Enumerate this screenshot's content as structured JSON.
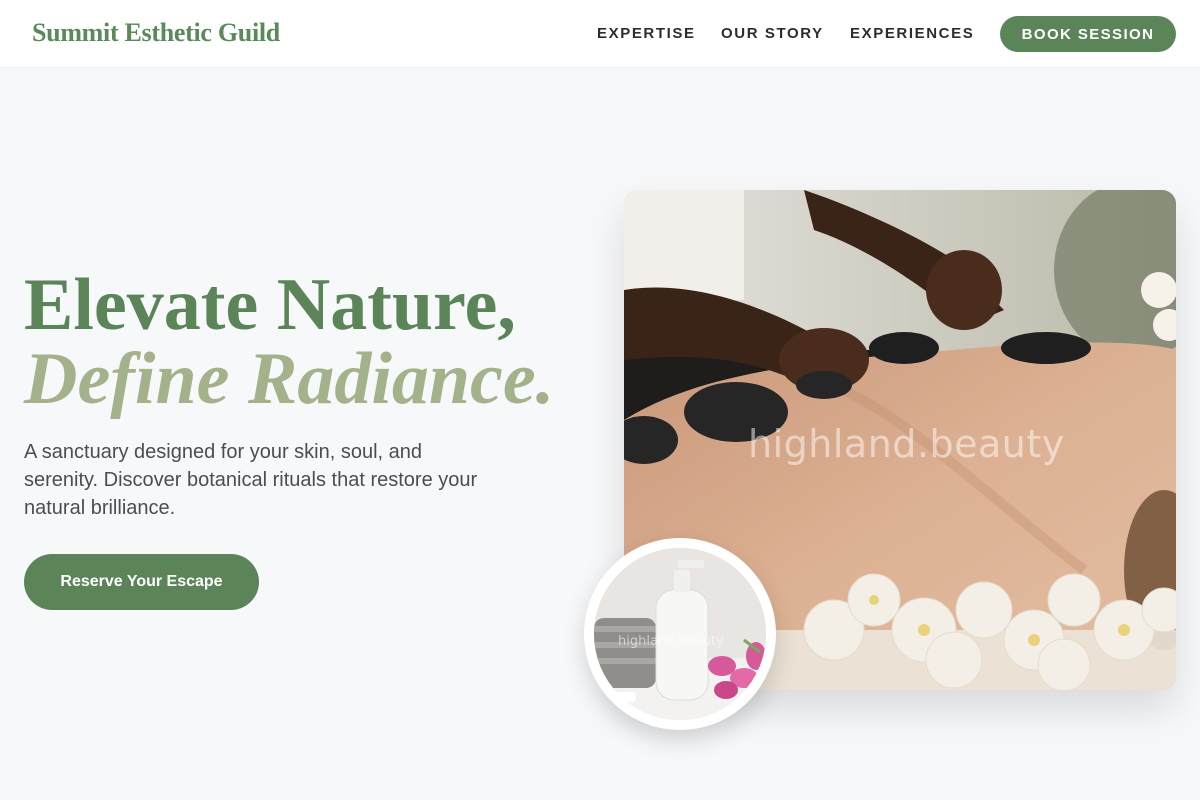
{
  "brand": {
    "name": "Summit Esthetic Guild"
  },
  "nav": {
    "items": [
      {
        "label": "EXPERTISE"
      },
      {
        "label": "OUR STORY"
      },
      {
        "label": "EXPERIENCES"
      }
    ],
    "book_label": "BOOK SESSION"
  },
  "hero": {
    "headline_line1": "Elevate Nature,",
    "headline_line2": "Define Radiance.",
    "lede": "A sanctuary designed for your skin, soul, and serenity. Discover botanical rituals that restore your natural brilliance.",
    "cta_label": "Reserve Your Escape",
    "main_image": {
      "watermark": "highland.beauty"
    },
    "inset_image": {
      "watermark": "highland.beauty"
    }
  },
  "colors": {
    "accent": "#5b8559",
    "accent_light": "#a3b28a",
    "text": "#4a4e54",
    "background": "#f7f8fa"
  }
}
